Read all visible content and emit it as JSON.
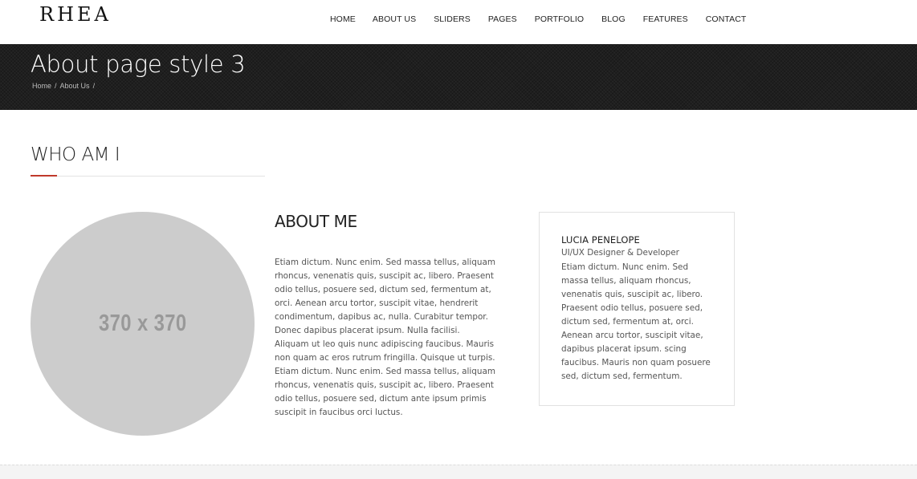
{
  "header": {
    "logo": "RHEA",
    "nav": [
      "HOME",
      "ABOUT US",
      "SLIDERS",
      "PAGES",
      "PORTFOLIO",
      "BLOG",
      "FEATURES",
      "CONTACT"
    ]
  },
  "banner": {
    "title": "About page style 3",
    "breadcrumb": [
      "Home",
      "About Us"
    ],
    "breadcrumb_separator": "/"
  },
  "section": {
    "title": "WHO AM I",
    "accent_color": "#c0392b"
  },
  "photo": {
    "placeholder_label": "370 x 370"
  },
  "about": {
    "heading": "ABOUT ME",
    "paragraphs": [
      "Etiam dictum. Nunc enim. Sed massa tellus, aliquam rhoncus, venenatis quis, suscipit ac, libero. Praesent odio tellus, posuere sed, dictum sed, fermentum at, orci. Aenean arcu tortor, suscipit vitae, hendrerit condimentum, dapibus ac, nulla. Curabitur tempor. Donec dapibus placerat ipsum. Nulla facilisi. Aliquam ut leo quis nunc adipiscing faucibus. Mauris non quam ac eros rutrum fringilla. Quisque ut turpis.",
      "Etiam dictum. Nunc enim. Sed massa tellus, aliquam rhoncus, venenatis quis, suscipit ac, libero. Praesent odio tellus, posuere sed, dictum ante ipsum primis suscipit in faucibus orci luctus."
    ]
  },
  "profile": {
    "name": "LUCIA PENELOPE",
    "role": "UI/UX Designer & Developer",
    "bio": "Etiam dictum. Nunc enim. Sed massa tellus, aliquam rhoncus, venenatis quis, suscipit ac, libero. Praesent odio tellus, posuere sed, dictum sed, fermentum at, orci. Aenean arcu tortor, suscipit vitae, dapibus placerat ipsum. scing faucibus. Mauris non quam posuere sed, dictum sed, fermentum."
  }
}
